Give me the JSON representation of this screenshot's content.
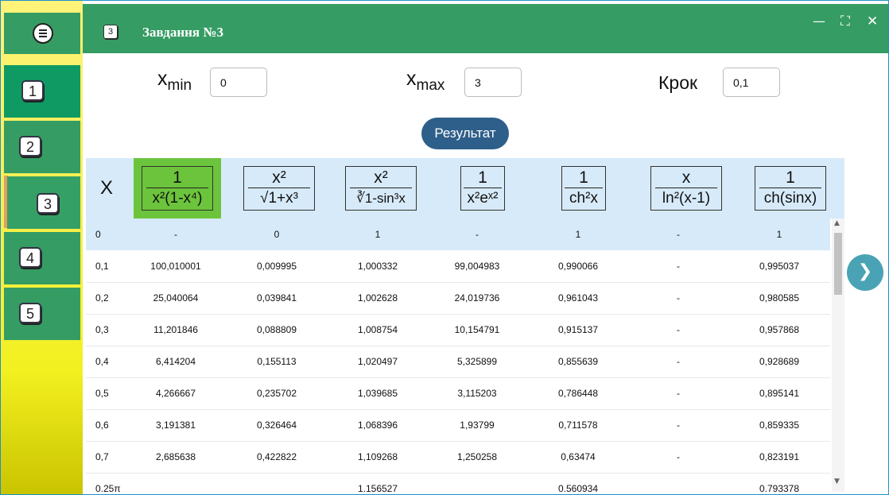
{
  "window": {
    "title_icon": "3",
    "title": "Завдання №3",
    "minimize": "—",
    "maximize": "⛶",
    "close": "✕"
  },
  "sidebar": {
    "menu_icon": "hamburger-menu-icon",
    "items": [
      {
        "label": "1"
      },
      {
        "label": "2"
      },
      {
        "label": "3"
      },
      {
        "label": "4"
      },
      {
        "label": "5"
      }
    ]
  },
  "inputs": {
    "xmin_label": "x",
    "xmin_sub": "min",
    "xmin_value": "0",
    "xmax_label": "x",
    "xmax_sub": "max",
    "xmax_value": "3",
    "step_label": "Крок",
    "step_value": "0,1"
  },
  "result_button": "Результат",
  "table": {
    "x_header": "X",
    "headers": [
      {
        "num": "1",
        "den": "x²(1-x⁴)"
      },
      {
        "num": "x²",
        "den": "√1+x³"
      },
      {
        "num": "x²",
        "den": "∛1-sin³x"
      },
      {
        "num": "1",
        "den": "x²eˣ²"
      },
      {
        "num": "1",
        "den": "ch²x"
      },
      {
        "num": "x",
        "den": "ln²(x-1)"
      },
      {
        "num": "1",
        "den": "ch(sinx)"
      }
    ],
    "rows": [
      [
        "0",
        "-",
        "0",
        "1",
        "-",
        "1",
        "-",
        "1"
      ],
      [
        "0,1",
        "100,010001",
        "0,009995",
        "1,000332",
        "99,004983",
        "0,990066",
        "-",
        "0,995037"
      ],
      [
        "0,2",
        "25,040064",
        "0,039841",
        "1,002628",
        "24,019736",
        "0,961043",
        "-",
        "0,980585"
      ],
      [
        "0,3",
        "11,201846",
        "0,088809",
        "1,008754",
        "10,154791",
        "0,915137",
        "-",
        "0,957868"
      ],
      [
        "0,4",
        "6,414204",
        "0,155113",
        "1,020497",
        "5,325899",
        "0,855639",
        "-",
        "0,928689"
      ],
      [
        "0,5",
        "4,266667",
        "0,235702",
        "1,039685",
        "3,115203",
        "0,786448",
        "-",
        "0,895141"
      ],
      [
        "0,6",
        "3,191381",
        "0,326464",
        "1,068396",
        "1,93799",
        "0,711578",
        "-",
        "0,859335"
      ],
      [
        "0,7",
        "2,685638",
        "0,422822",
        "1,109268",
        "1,250258",
        "0,63474",
        "-",
        "0,823191"
      ],
      [
        "0,25π",
        "",
        "",
        "1,156527",
        "",
        "0,560934",
        "",
        "0,793378"
      ]
    ]
  },
  "next_button_icon": "chevron-right-icon"
}
